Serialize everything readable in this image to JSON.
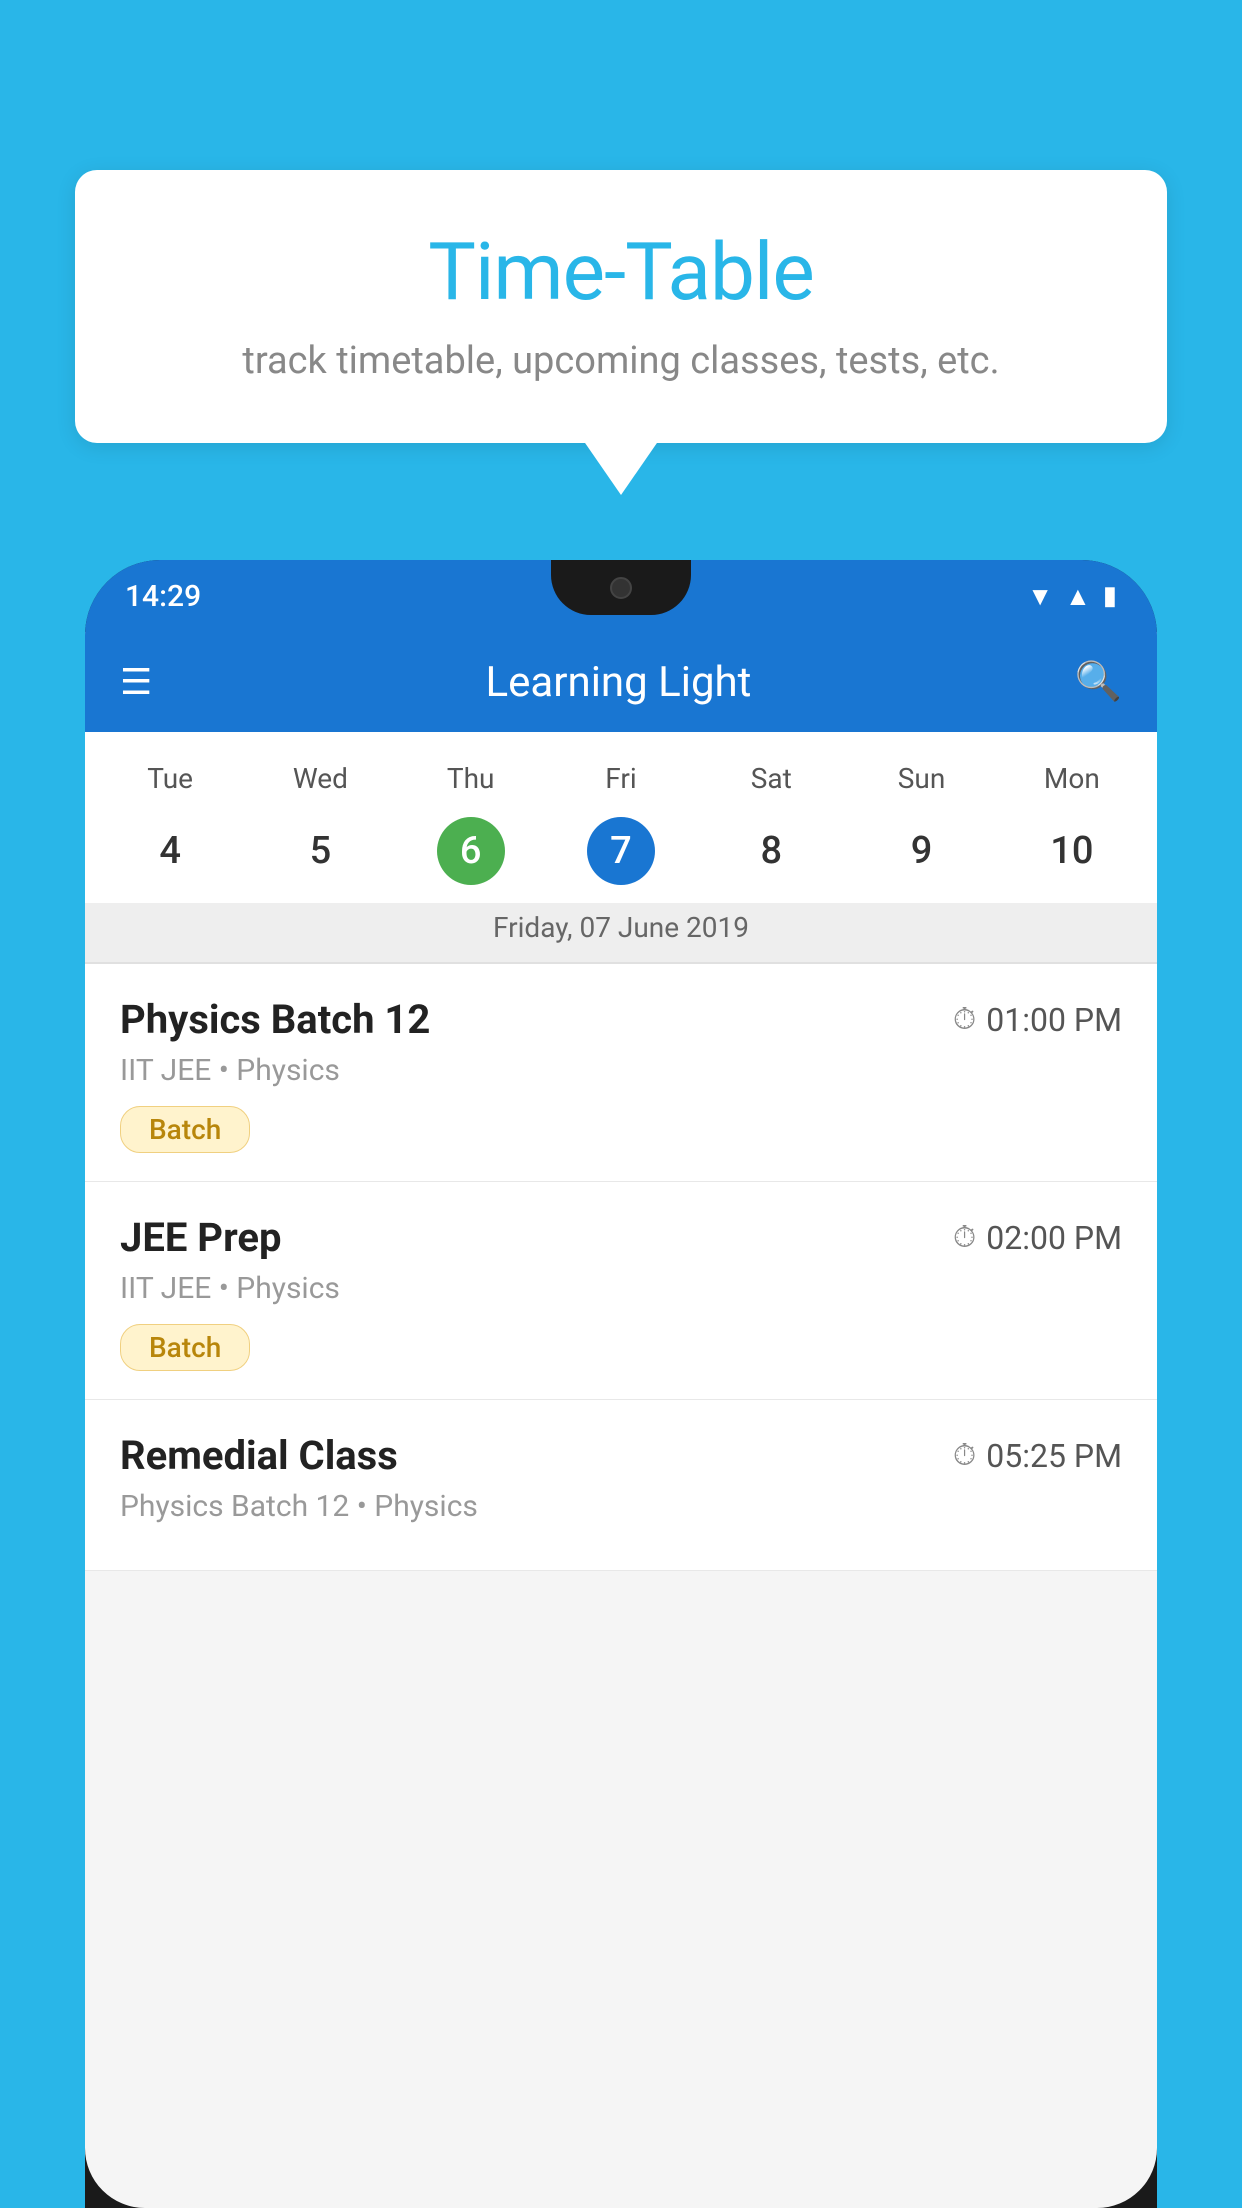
{
  "background_color": "#29b6e8",
  "bubble": {
    "title": "Time-Table",
    "subtitle": "track timetable, upcoming classes, tests, etc."
  },
  "phone": {
    "status_bar": {
      "time": "14:29"
    },
    "app_bar": {
      "title": "Learning Light"
    },
    "calendar": {
      "days": [
        {
          "label": "Tue",
          "number": "4"
        },
        {
          "label": "Wed",
          "number": "5"
        },
        {
          "label": "Thu",
          "number": "6",
          "state": "today"
        },
        {
          "label": "Fri",
          "number": "7",
          "state": "selected"
        },
        {
          "label": "Sat",
          "number": "8"
        },
        {
          "label": "Sun",
          "number": "9"
        },
        {
          "label": "Mon",
          "number": "10"
        }
      ],
      "selected_date_label": "Friday, 07 June 2019"
    },
    "schedule": [
      {
        "title": "Physics Batch 12",
        "time": "01:00 PM",
        "subtitle": "IIT JEE • Physics",
        "badge": "Batch"
      },
      {
        "title": "JEE Prep",
        "time": "02:00 PM",
        "subtitle": "IIT JEE • Physics",
        "badge": "Batch"
      },
      {
        "title": "Remedial Class",
        "time": "05:25 PM",
        "subtitle": "Physics Batch 12 • Physics",
        "badge": null
      }
    ]
  }
}
